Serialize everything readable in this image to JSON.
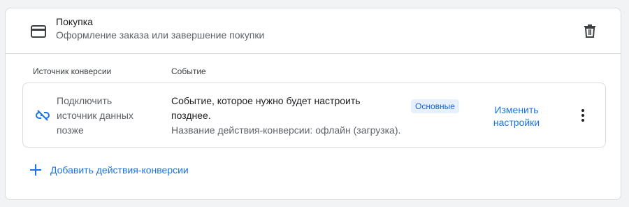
{
  "header": {
    "title": "Покупка",
    "subtitle": "Оформление заказа или завершение покупки",
    "card_icon": "credit-card-icon",
    "delete_icon": "trash-icon"
  },
  "columns": {
    "source": "Источник конверсии",
    "event": "Событие"
  },
  "row": {
    "source_lines": [
      "Подключить",
      "источник данных",
      "позже"
    ],
    "source_icon": "link-off-icon",
    "event_lines": [
      "Событие, которое нужно будет настроить",
      "позднее."
    ],
    "event_sub": "Название действия-конверсии: офлайн (загрузка).",
    "badge": "Основные",
    "edit_lines": [
      "Изменить",
      "настройки"
    ],
    "more_icon": "more-vert-icon"
  },
  "add_action": {
    "label": "Добавить действия-конверсии",
    "icon": "plus-icon"
  },
  "colors": {
    "accent": "#1a73e8",
    "badge_bg": "#e8f0fe",
    "border": "#dadce0",
    "page_bg": "#f1f3f4"
  }
}
